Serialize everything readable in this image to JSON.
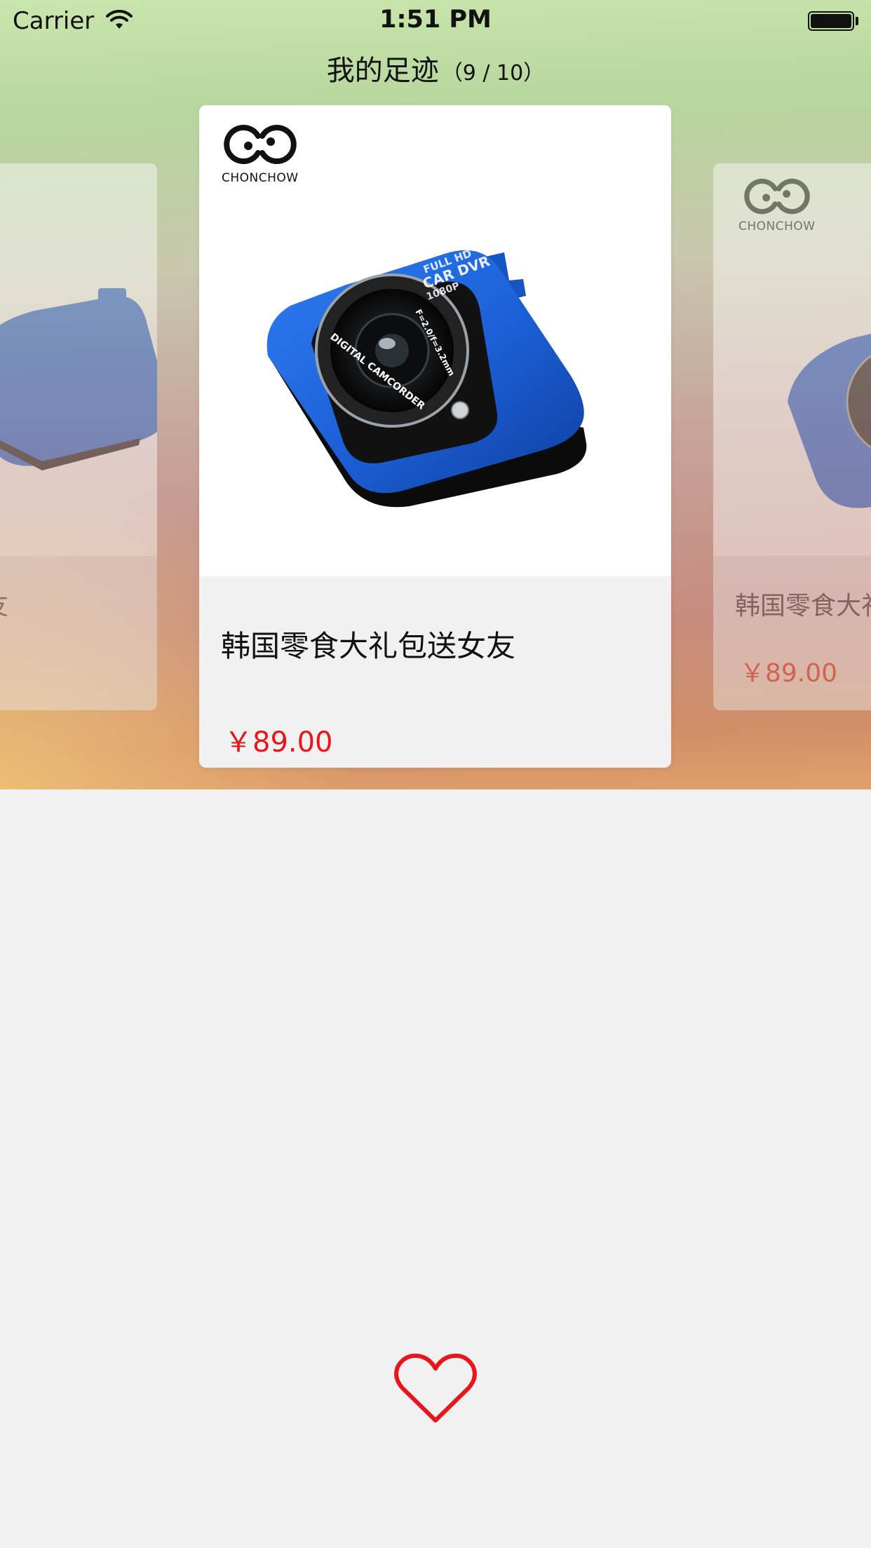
{
  "status_bar": {
    "carrier": "Carrier",
    "time": "1:51 PM"
  },
  "header": {
    "title": "我的足迹",
    "counter": "（9 / 10）"
  },
  "brand": {
    "logo_text": "CHONCHOW"
  },
  "cards": {
    "center": {
      "name": "韩国零食大礼包送女友",
      "price": "￥89.00",
      "image_labels": [
        "FULL HD",
        "CAR DVR",
        "1080P",
        "F=2.0/f=3.2mm",
        "DIGITAL CAMCORDER"
      ]
    },
    "right": {
      "name": "韩国零食大礼包送女友",
      "price": "￥89.00"
    },
    "left": {
      "name": "友"
    }
  },
  "colors": {
    "price": "#e8151b",
    "heart": "#e8151b",
    "camera_body": "#1b5fd6"
  },
  "icons": {
    "favorite": "heart-outline-icon",
    "wifi": "wifi-icon",
    "battery": "battery-icon"
  }
}
